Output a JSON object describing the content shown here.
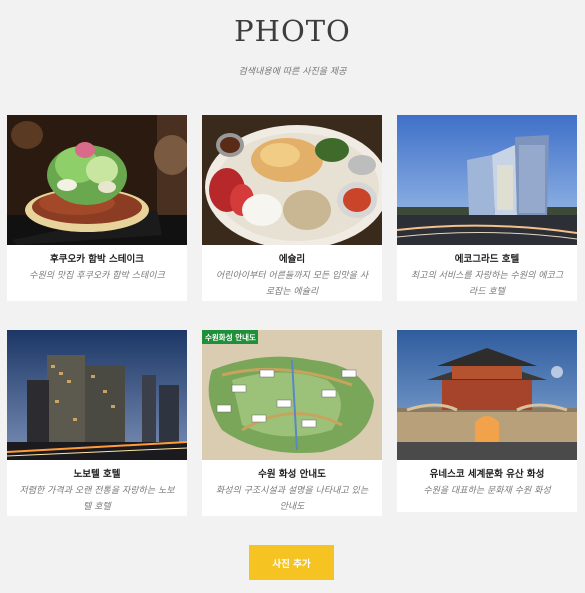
{
  "header": {
    "title": "PHOTO",
    "subtitle": "검색내용에 따른 사진을 제공"
  },
  "cards": [
    {
      "name": "후쿠오카 함박 스테이크",
      "desc": "수원의 맛집 후쿠오카 함박 스테이크",
      "image": "hamburg-steak-photo"
    },
    {
      "name": "에슐리",
      "desc": "어린아이부터 어른들까지 모든 입맛을 사로잡는 에슐리",
      "image": "ashley-buffet-photo"
    },
    {
      "name": "에코그라드 호텔",
      "desc": "최고의 서비스를 자랑하는 수원의 에코그라드 호텔",
      "image": "ecograd-hotel-photo"
    },
    {
      "name": "노보텔 호텔",
      "desc": "저렴한 가격과 오랜 전통을 자랑하는 노보텔 호텔",
      "image": "novotel-hotel-photo"
    },
    {
      "name": "수원 화성 안내도",
      "desc": "화성의 구조시설과 설명을 나타내고 있는 안내도",
      "image": "hwaseong-map-photo",
      "image_label": "수원화성 안내도"
    },
    {
      "name": "유네스코 세계문화 유산 화성",
      "desc": "수원을 대표하는 문화재 수원 화성",
      "image": "hwaseong-gate-photo"
    }
  ],
  "actions": {
    "add_photo_label": "사진 추가"
  },
  "colors": {
    "background": "#f2f2f2",
    "card": "#ffffff",
    "button": "#f5c322"
  }
}
